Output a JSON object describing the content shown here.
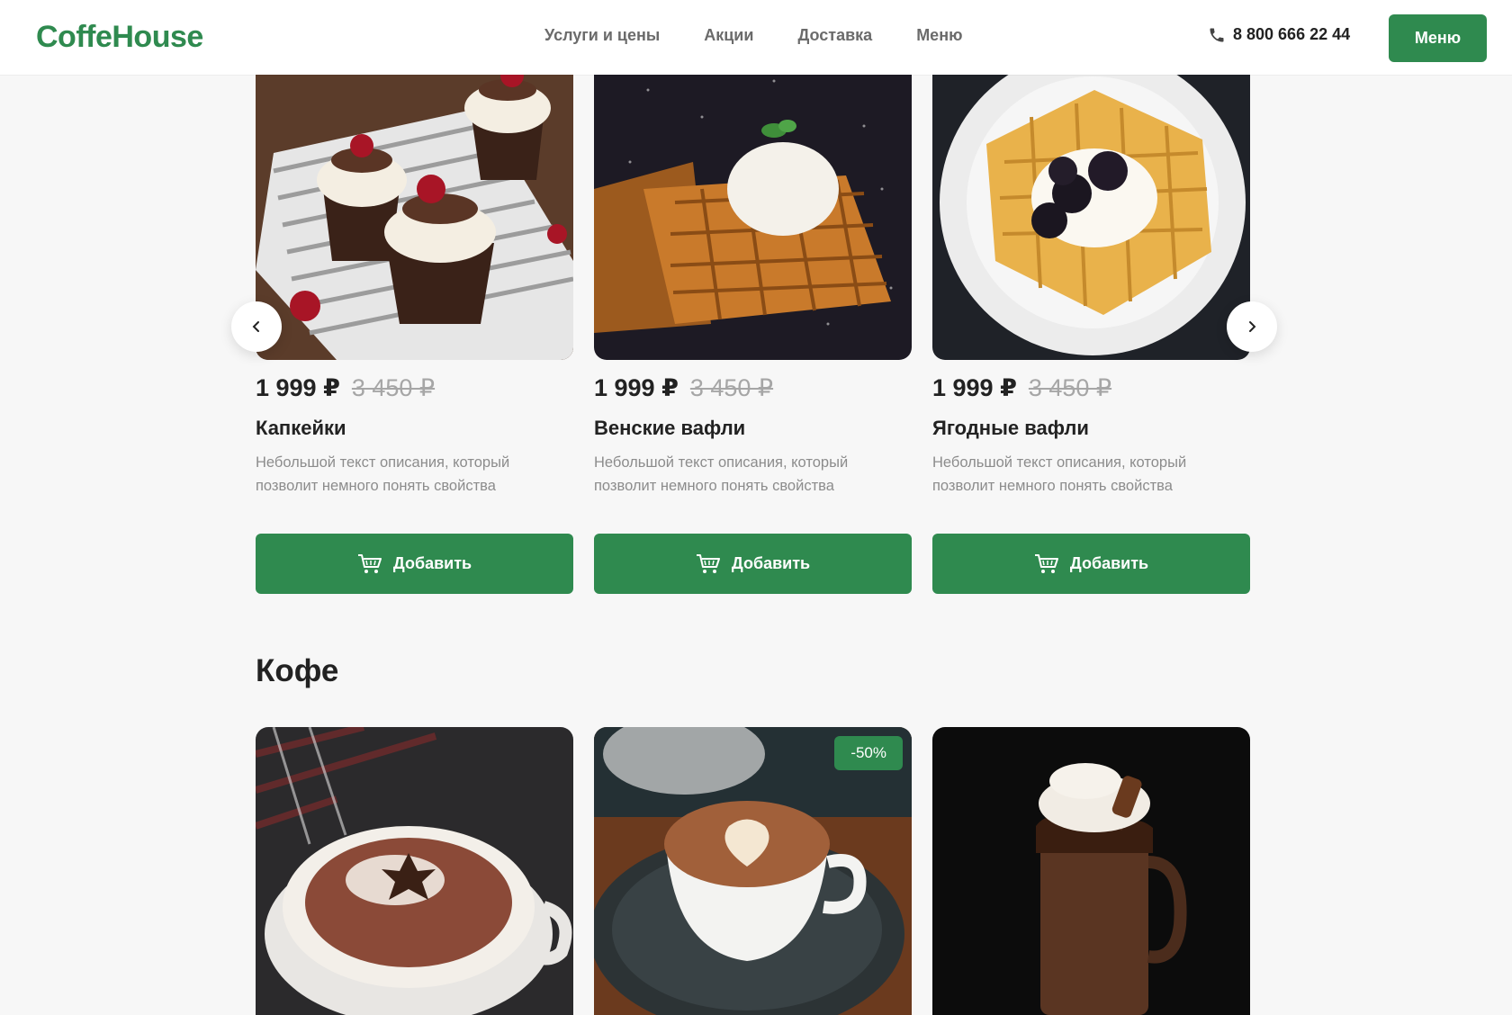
{
  "header": {
    "logo": "CoffeHouse",
    "nav": [
      "Услуги и цены",
      "Акции",
      "Доставка",
      "Меню"
    ],
    "phone": "8 800 666 22 44",
    "menu_button": "Меню"
  },
  "desserts": {
    "items": [
      {
        "title": "Капкейки",
        "price": "1 999 ₽",
        "old_price": "3 450 ₽",
        "description": "Небольшой текст описания, который позволит немного понять свойства",
        "button": "Добавить"
      },
      {
        "title": "Венские вафли",
        "price": "1 999 ₽",
        "old_price": "3 450 ₽",
        "description": "Небольшой текст описания, который позволит немного понять свойства",
        "button": "Добавить"
      },
      {
        "title": "Ягодные вафли",
        "price": "1 999 ₽",
        "old_price": "3 450 ₽",
        "description": "Небольшой текст описания, который позволит немного понять свойства",
        "button": "Добавить"
      }
    ]
  },
  "coffee": {
    "title": "Кофе",
    "badge": "-50%"
  },
  "colors": {
    "accent": "#2f8a4f",
    "background": "#f7f7f7"
  }
}
